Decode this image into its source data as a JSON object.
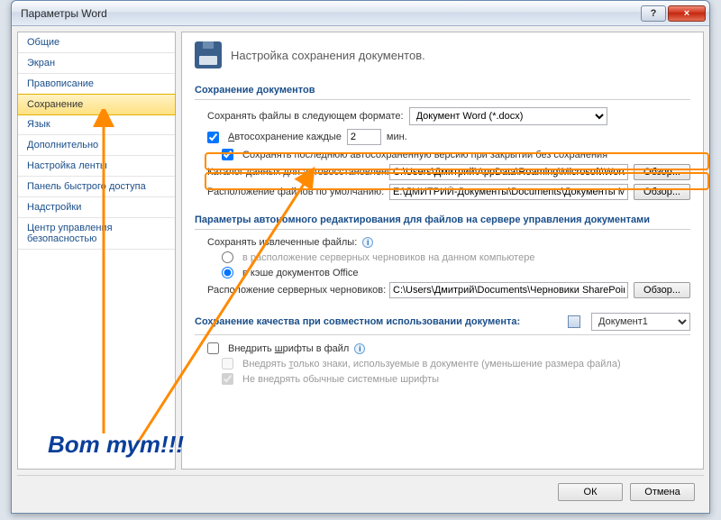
{
  "window": {
    "title": "Параметры Word"
  },
  "win_buttons": {
    "help": "?",
    "close": "×"
  },
  "sidebar": {
    "items": [
      {
        "label": "Общие"
      },
      {
        "label": "Экран"
      },
      {
        "label": "Правописание"
      },
      {
        "label": "Сохранение"
      },
      {
        "label": "Язык"
      },
      {
        "label": "Дополнительно"
      },
      {
        "label": "Настройка ленты"
      },
      {
        "label": "Панель быстрого доступа"
      },
      {
        "label": "Надстройки"
      },
      {
        "label": "Центр управления безопасностью"
      }
    ],
    "active_index": 3
  },
  "header": {
    "text": "Настройка сохранения документов."
  },
  "sec1": {
    "title": "Сохранение документов",
    "format_label": "Сохранять файлы в следующем формате:",
    "format_value": "Документ Word (*.docx)",
    "autosave_label": "Автосохранение каждые",
    "autosave_value": "2",
    "autosave_unit": "мин.",
    "keep_last_label": "Сохранять последнюю автосохраненную версию при закрытии без сохранения",
    "autorecover_label": "Каталог данных для автовосстановления:",
    "autorecover_value": "C:\\Users\\Дмитрий\\AppData\\Roaming\\Microsoft\\Word\\",
    "default_loc_label": "Расположение файлов по умолчанию:",
    "default_loc_value": "E:\\ДМИТРИЙ-Документы\\Documents\\Документы Microsoft Word",
    "browse": "Обзор..."
  },
  "sec2": {
    "title": "Параметры автономного редактирования для файлов на сервере управления документами",
    "save_extracted_label": "Сохранять извлеченные файлы:",
    "radio1": "в расположение серверных черновиков на данном компьютере",
    "radio2": "в кэше документов Office",
    "drafts_label": "Расположение серверных черновиков:",
    "drafts_value": "C:\\Users\\Дмитрий\\Documents\\Черновики SharePoint\\",
    "browse": "Обзор..."
  },
  "sec3": {
    "title": "Сохранение качества при совместном использовании документа:",
    "doc_name": "Документ1",
    "embed_fonts": "Внедрить шрифты в файл",
    "embed_only_used": "Внедрять только знаки, используемые в документе (уменьшение размера файла)",
    "no_system_fonts": "Не внедрять обычные системные шрифты"
  },
  "footer": {
    "ok": "ОК",
    "cancel": "Отмена"
  },
  "callout": "Вот тут!!!"
}
